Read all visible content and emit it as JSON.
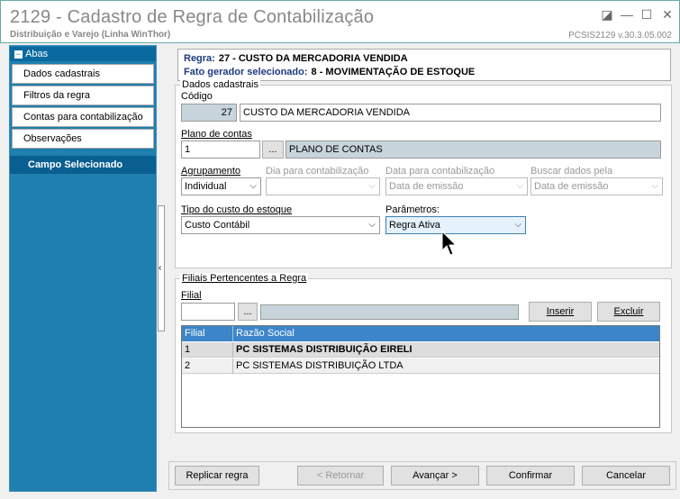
{
  "window": {
    "title": "2129 - Cadastro de Regra de Contabilização",
    "subtitle": "Distribuição e Varejo (Linha WinThor)",
    "version": "PCSIS2129  v.30.3.05.002",
    "controls": [
      "restore-icon",
      "minimize-icon",
      "maximize-icon",
      "close-icon"
    ]
  },
  "sidebar": {
    "header": "Abas",
    "items": [
      {
        "label": "Dados cadastrais"
      },
      {
        "label": "Filtros da regra"
      },
      {
        "label": "Contas para contabilização"
      },
      {
        "label": "Observações"
      }
    ],
    "campo_selecionado": "Campo Selecionado"
  },
  "header": {
    "regra_label": "Regra:",
    "regra_value": "27 - CUSTO DA MERCADORIA VENDIDA",
    "fato_label": "Fato gerador selecionado:",
    "fato_value": "8 - MOVIMENTAÇÃO DE ESTOQUE"
  },
  "dados": {
    "group_title": "Dados cadastrais",
    "codigo_label": "Código",
    "codigo_value": "27",
    "descricao_value": "CUSTO DA MERCADORIA VENDIDA",
    "plano_label": "Plano de contas",
    "plano_code": "1",
    "lookup_btn": "...",
    "plano_desc": "PLANO DE CONTAS",
    "agrupamento_label": "Agrupamento",
    "agrupamento_value": "Individual",
    "dia_label": "Dia para contabilização",
    "dia_value": "",
    "data_label": "Data para contabilização",
    "data_value": "Data de emissão",
    "buscar_label": "Buscar dados pela",
    "buscar_value": "Data de emissão",
    "tipo_label": "Tipo do custo do estoque",
    "tipo_value": "Custo Contábil",
    "parametros_label": "Parâmetros:",
    "parametros_value": "Regra Ativa"
  },
  "filiais": {
    "group_title": "Filiais Pertencentes a Regra",
    "filial_label": "Filial",
    "filial_value": "",
    "lookup_btn": "...",
    "filial_desc": "",
    "inserir": "Inserir",
    "excluir": "Excluir",
    "columns": [
      "Filial",
      "Razão Social"
    ],
    "rows": [
      {
        "filial": "1",
        "razao": "PC SISTEMAS DISTRIBUIÇÃO  EIRELI"
      },
      {
        "filial": "2",
        "razao": "PC SISTEMAS DISTRIBUIÇÃO LTDA"
      }
    ]
  },
  "footer": {
    "replicar": "Replicar regra",
    "retornar": "< Retornar",
    "avancar": "Avançar >",
    "confirmar": "Confirmar",
    "cancelar": "Cancelar"
  },
  "colors": {
    "sidebar_bg": "#1f7fae",
    "grid_header": "#3c85c8",
    "header_text": "#1f3a80"
  }
}
